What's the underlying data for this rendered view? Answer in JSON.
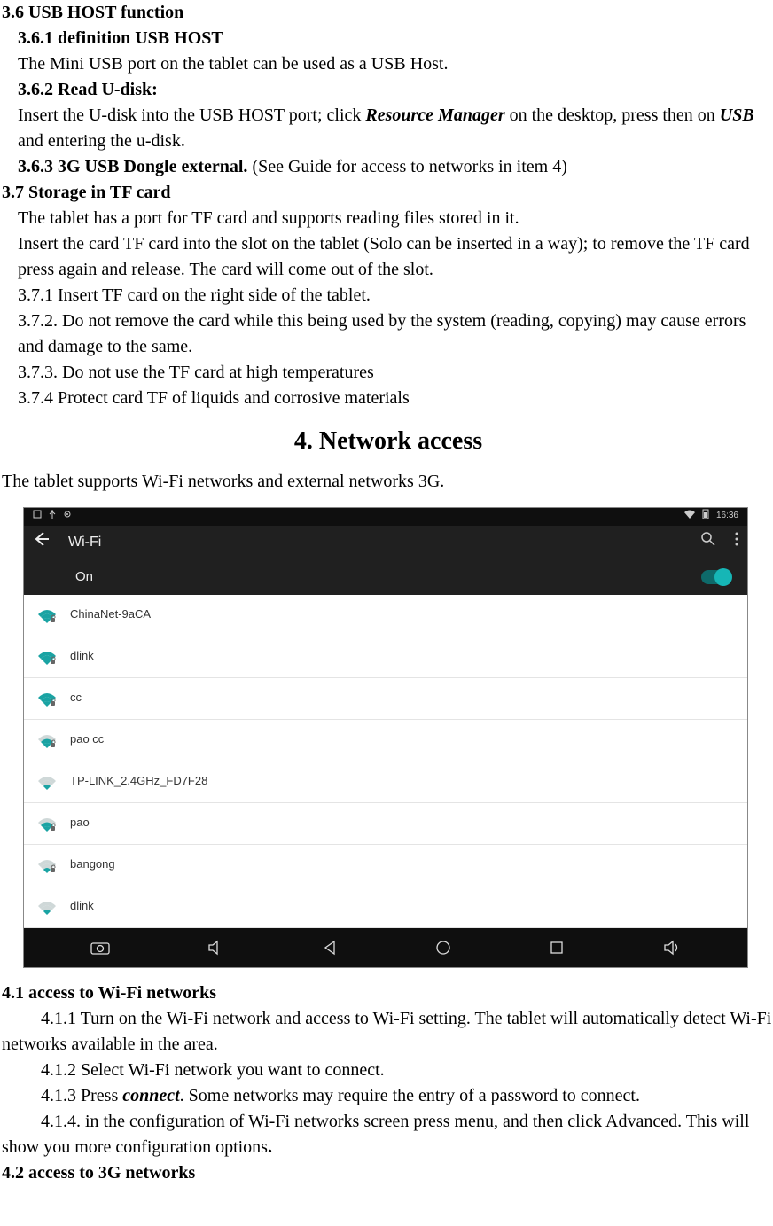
{
  "sec36": {
    "heading": "3.6 USB HOST function",
    "s361_heading": "3.6.1 definition USB HOST",
    "s361_body": "The Mini USB port on the tablet can be used as a USB Host.",
    "s362_heading": "3.6.2 Read U-disk:",
    "s362_pre": "Insert the U-disk into the USB HOST port; click ",
    "s362_em1": "Resource Manager",
    "s362_mid": " on the desktop, press then on ",
    "s362_em2": "USB",
    "s362_post": " and entering the u-disk.",
    "s363_heading": "3.6.3 3G USB Dongle external.",
    "s363_rest": " (See Guide for access to networks in item 4)"
  },
  "sec37": {
    "heading": "3.7 Storage in TF card",
    "body1": "The tablet has a port for TF card and supports reading files stored in it.",
    "body2": "Insert the card TF card into the slot on the tablet (Solo can be inserted in a way); to remove the TF card press again and release. The card will come out of the slot.",
    "i1": "3.7.1 Insert TF card on the right side of the tablet.",
    "i2": "3.7.2. Do not remove the card while this being used by the system (reading, copying) may cause errors and damage to the same.",
    "i3": "3.7.3. Do not use the TF card at high temperatures",
    "i4": "3.7.4 Protect card TF of liquids and corrosive materials"
  },
  "sec4": {
    "title": "4. Network access",
    "intro": "The tablet supports Wi-Fi networks and external networks 3G."
  },
  "screenshot": {
    "time": "16:36",
    "title": "Wi-Fi",
    "on_label": "On",
    "networks": [
      {
        "name": "ChinaNet-9aCA",
        "locked": true,
        "strength": "full"
      },
      {
        "name": "dlink",
        "locked": true,
        "strength": "full"
      },
      {
        "name": "cc",
        "locked": true,
        "strength": "full"
      },
      {
        "name": "pao cc",
        "locked": true,
        "strength": "high"
      },
      {
        "name": "TP-LINK_2.4GHz_FD7F28",
        "locked": false,
        "strength": "mid"
      },
      {
        "name": "pao",
        "locked": true,
        "strength": "high"
      },
      {
        "name": "bangong",
        "locked": true,
        "strength": "mid"
      },
      {
        "name": "dlink",
        "locked": false,
        "strength": "mid"
      }
    ]
  },
  "sec41": {
    "heading": "4.1 access to Wi-Fi networks",
    "i1": "4.1.1 Turn on the Wi-Fi network and access to Wi-Fi setting. The tablet will automatically detect Wi-Fi networks available in the area.",
    "i2": "4.1.2 Select Wi-Fi network you want to connect.",
    "i3_pre": "4.1.3 Press ",
    "i3_em": "connect",
    "i3_post": ". Some networks may require the entry of a password to connect.",
    "i4_pre": "4.1.4. in the configuration of Wi-Fi networks screen press menu, and then click Advanced. This will show you more configuration options",
    "i4_dot": "."
  },
  "sec42": {
    "heading": "4.2 access to 3G networks"
  }
}
